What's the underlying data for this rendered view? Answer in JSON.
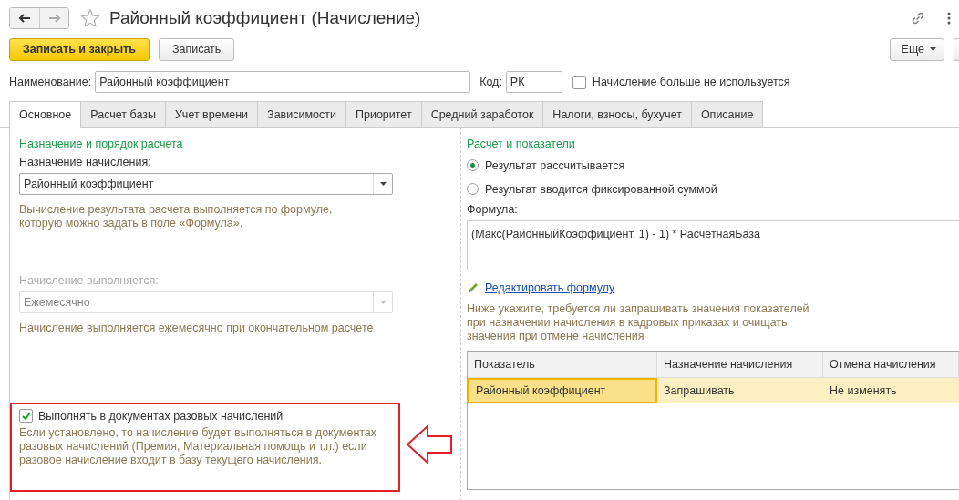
{
  "window": {
    "title": "Районный коэффициент (Начисление)"
  },
  "toolbar": {
    "buttons": [
      {
        "label": "Записать и закрыть",
        "kind": "primary"
      },
      {
        "label": "Записать",
        "kind": "normal"
      }
    ],
    "more": "Еще"
  },
  "header": {
    "name_label": "Наименование:",
    "name_value": "Районный коэффициент",
    "code_label": "Код:",
    "code_value": "РК",
    "unused": {
      "label": "Начисление больше не используется",
      "checked": false
    }
  },
  "tabs": [
    {
      "label": "Основное",
      "selected": true
    },
    {
      "label": "Расчет базы",
      "selected": false
    },
    {
      "label": "Учет времени",
      "selected": false
    },
    {
      "label": "Зависимости",
      "selected": false
    },
    {
      "label": "Приоритет",
      "selected": false
    },
    {
      "label": "Средний заработок",
      "selected": false
    },
    {
      "label": "Налоги, взносы, бухучет",
      "selected": false
    },
    {
      "label": "Описание",
      "selected": false
    }
  ],
  "left": {
    "section_title": "Назначение и порядок расчета",
    "purpose_label": "Назначение начисления:",
    "purpose_value": "Районный коэффициент",
    "purpose_hint": "Вычисление результата расчета выполняется по формуле, которую можно задать в поле «Формула».",
    "schedule_label": "Начисление выполняется:",
    "schedule_value": "Ежемесячно",
    "schedule_disabled": true,
    "schedule_hint": "Начисление выполняется ежемесячно при окончательном расчете",
    "one_time": {
      "label": "Выполнять в документах разовых начислений",
      "checked": true,
      "hint": "Если установлено, то начисление будет выполняться в документах разовых начислений (Премия, Материальная помощь и т.п.) если разовое начисление входит в базу текущего начисления."
    }
  },
  "right": {
    "section_title": "Расчет и показатели",
    "result_options": [
      {
        "label": "Результат рассчитывается",
        "selected": true
      },
      {
        "label": "Результат вводится фиксированной суммой",
        "selected": false
      }
    ],
    "formula_label": "Формула:",
    "formula": "(Макс(РайонныйКоэффициент, 1) - 1) * РасчетнаяБаза",
    "edit_link": "Редактировать формулу",
    "indicators_hint": "Ниже укажите, требуется ли запрашивать значения показателей при назначении начисления в кадровых приказах и очищать значения при отмене начисления",
    "table": {
      "columns": [
        "Показатель",
        "Назначение начисления",
        "Отмена начисления"
      ],
      "rows": [
        {
          "cells": [
            "Районный коэффициент",
            "Запрашивать",
            "Не изменять"
          ],
          "selected": true
        }
      ]
    }
  }
}
